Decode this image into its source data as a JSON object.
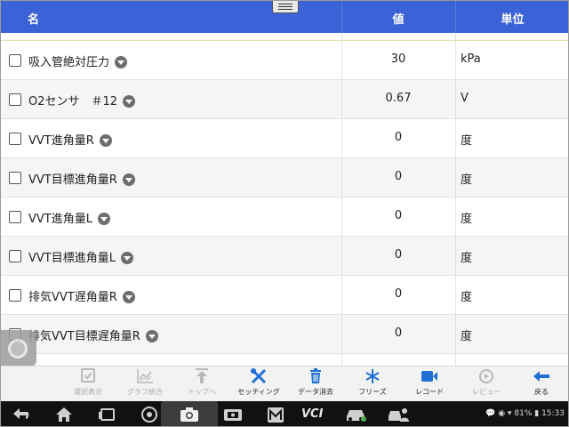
{
  "header": {
    "name": "名",
    "value": "値",
    "unit": "単位"
  },
  "rows": [
    {
      "name": "吸入管絶対圧力",
      "value": "30",
      "unit": "kPa"
    },
    {
      "name": "O2センサ　＃12",
      "value": "0.67",
      "unit": "V"
    },
    {
      "name": "VVT進角量R",
      "value": "0",
      "unit": "度"
    },
    {
      "name": "VVT目標進角量R",
      "value": "0",
      "unit": "度"
    },
    {
      "name": "VVT進角量L",
      "value": "0",
      "unit": "度"
    },
    {
      "name": "VVT目標進角量L",
      "value": "0",
      "unit": "度"
    },
    {
      "name": "排気VVT遅角量R",
      "value": "0",
      "unit": "度"
    },
    {
      "name": "排気VVT目標遅角量R",
      "value": "0",
      "unit": "度"
    }
  ],
  "toolbar": {
    "select_display": "選択表示",
    "graph_merge": "グラフ統合",
    "to_top": "トップへ",
    "setting": "セッティング",
    "data_clear": "データ消去",
    "freeze": "フリーズ",
    "record": "レコード",
    "review": "レビュー",
    "back": "戻る"
  },
  "status": {
    "battery": "81%",
    "time": "15:33"
  },
  "navbar": {
    "vci_label": "VCI"
  },
  "colors": {
    "header_bg": "#3b62d6",
    "accent_blue": "#1f6fd6",
    "disabled_gray": "#b8b8b8"
  }
}
